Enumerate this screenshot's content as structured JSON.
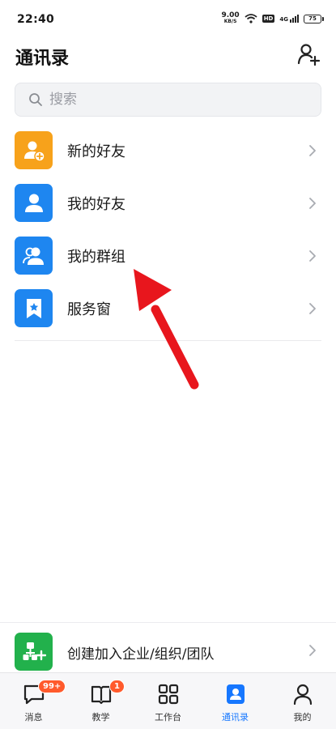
{
  "status_bar": {
    "time": "22:40",
    "net_speed_value": "9.00",
    "net_speed_unit": "KB/S",
    "hd": "HD",
    "network": "4G",
    "battery": "75"
  },
  "header": {
    "title": "通讯录",
    "add_icon": "add-contact-icon"
  },
  "search": {
    "placeholder": "搜索"
  },
  "menu": {
    "items": [
      {
        "label": "新的好友",
        "icon": "new-friend-icon",
        "color": "#f7a21b"
      },
      {
        "label": "我的好友",
        "icon": "my-friends-icon",
        "color": "#1e86f0"
      },
      {
        "label": "我的群组",
        "icon": "my-groups-icon",
        "color": "#1e86f0"
      },
      {
        "label": "服务窗",
        "icon": "service-window-icon",
        "color": "#1e86f0"
      }
    ]
  },
  "create": {
    "label": "创建加入企业/组织/团队",
    "icon": "org-chart-icon",
    "color": "#22b14c"
  },
  "annotation": {
    "arrow_color": "#e8161d"
  },
  "tabs": [
    {
      "label": "消息",
      "icon": "message-icon",
      "badge": "99+"
    },
    {
      "label": "教学",
      "icon": "book-icon",
      "badge": "1"
    },
    {
      "label": "工作台",
      "icon": "grid-icon",
      "badge": ""
    },
    {
      "label": "通讯录",
      "icon": "contacts-icon",
      "badge": "",
      "active": true
    },
    {
      "label": "我的",
      "icon": "profile-icon",
      "badge": ""
    }
  ],
  "colors": {
    "accent": "#1677ff",
    "badge": "#ff5a2c"
  }
}
